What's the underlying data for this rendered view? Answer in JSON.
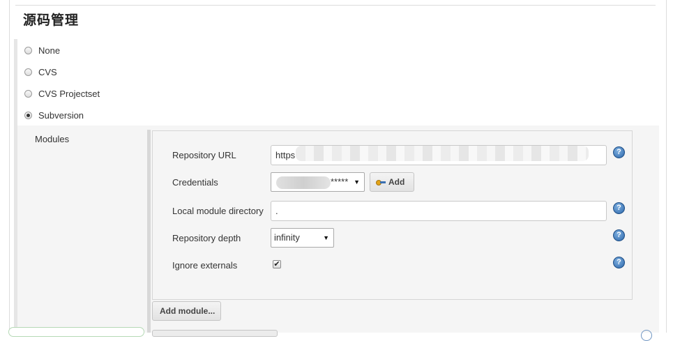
{
  "section": {
    "title": "源码管理"
  },
  "scm_options": [
    {
      "label": "None",
      "selected": false
    },
    {
      "label": "CVS",
      "selected": false
    },
    {
      "label": "CVS Projectset",
      "selected": false
    },
    {
      "label": "Subversion",
      "selected": true
    }
  ],
  "modules": {
    "label": "Modules",
    "repository_url": {
      "label": "Repository URL",
      "value": "https"
    },
    "credentials": {
      "label": "Credentials",
      "value": "*****",
      "add_label": "Add"
    },
    "local_module_directory": {
      "label": "Local module directory",
      "value": "."
    },
    "repository_depth": {
      "label": "Repository depth",
      "value": "infinity"
    },
    "ignore_externals": {
      "label": "Ignore externals",
      "checked": true,
      "check_mark": "✔"
    },
    "help_glyph": "?",
    "add_module_label": "Add module..."
  },
  "icons": [
    "help-icon",
    "key-icon",
    "dropdown-arrow-icon",
    "checkbox-checked"
  ],
  "colors": {
    "help_blue": "#2c67ab",
    "section_bg": "#f5f5f5"
  }
}
